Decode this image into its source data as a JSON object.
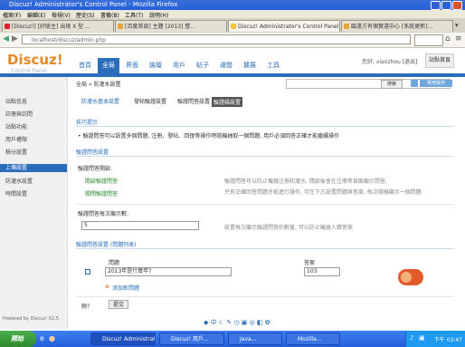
{
  "window": {
    "title": "Discuz! Administrator's Control Panel - Mozilla Firefox"
  },
  "menubar": [
    "檔案(F)",
    "編輯(E)",
    "檢視(V)",
    "歷史(S)",
    "書籤(B)",
    "工具(T)",
    "說明(H)"
  ],
  "browser_tabs": [
    {
      "label": "[Discuz!] [好版主] 出現 X 型 ...",
      "active": false,
      "favicon_color": "#d23"
    },
    {
      "label": "[百度首頁] 主題 [2013] 整...",
      "active": false,
      "favicon_color": "#e8a33a"
    },
    {
      "label": "Discuz! Administrator's Control Panel",
      "active": true,
      "favicon_color": "#f3c33a"
    },
    {
      "label": "臨遠方有個實遠中心 [系統更新]...",
      "active": false,
      "favicon_color": "#e8a33a"
    }
  ],
  "navbar": {
    "url": "localhost/discuz/admin.php"
  },
  "header": {
    "logo": "Discuz!",
    "logo_sub": "Control Panel",
    "nav_tabs": [
      "首頁",
      "全局",
      "界面",
      "論壇",
      "用戶",
      "帖子",
      "運營",
      "擴展",
      "工具"
    ],
    "active_nav": 1,
    "user_text": "您好, xiaozhou [退出]",
    "home_button": "站點首頁"
  },
  "sidebar": {
    "items": [
      "站點信息",
      "註冊與訪問",
      "站點功能",
      "用戶權限",
      "積分設置",
      "上傳設置",
      "防灌水設置",
      "時間設置",
      "手機版設置"
    ],
    "active_index": 5,
    "powered": "Powered by Discuz! X2.5"
  },
  "main": {
    "breadcrumb": "全局 » 防灌水設置",
    "search_button": "搜索",
    "add_button": "常用操作",
    "subtabs": [
      "防灌水基本設置",
      "發帖驗證設置",
      "驗證問答設置",
      "驗證碼設置"
    ],
    "active_subtab": 3,
    "tips_heading": "技巧提示",
    "tips_text": "• 驗證問答可以設置多個問題, 注冊、發帖、回復等操作時隨機抽取一個問題, 用戶必須回答正確才能繼續操作",
    "section1_heading": "驗證問答設置",
    "section1_label": "驗證問答開啟:",
    "option_enabled": "開啟驗證問答",
    "option_disabled": "關閉驗證問答",
    "section1_desc_line1": "驗證問答可以防止機器注冊和灌水, 開啟後會在注冊等頁面顯示問答,",
    "section1_desc_line2": "只有正確回答問題才能進行操作, 可在下方設置問題與答案, 每次隨機顯示一個問題",
    "count_label": "驗證問答每次顯示數:",
    "count_value": "5",
    "count_desc": "設置每次顯示驗證問答的數量, 可以防止機器人猜答案",
    "section2_heading": "驗證問答設置 (問題列表)",
    "col_question": "問題",
    "col_answer": "答案",
    "row_question": "2013年是什麼年?",
    "row_answer": "103",
    "add_link": "添加新問題",
    "delete_label": "刪?",
    "submit_button": "提交"
  },
  "bottom_toolbar": "◆ 中 ☾ ✎ ◷ ▣ ◎ ◧ ✿",
  "taskbar": {
    "start": "開始",
    "items": [
      "Discuz! Administrat...",
      "Discuz! 用戶...",
      "Java...",
      "Mozilla..."
    ],
    "clock": "下午 03:47"
  }
}
